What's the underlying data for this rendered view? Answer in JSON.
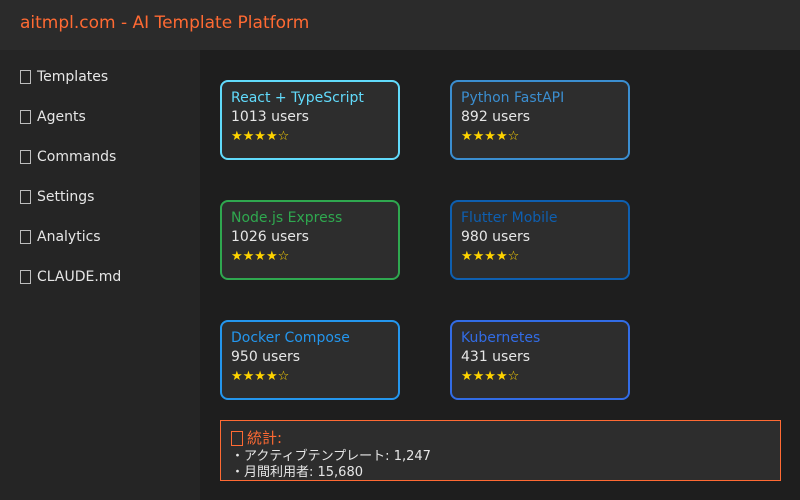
{
  "header": {
    "title": "aitmpl.com - AI Template Platform"
  },
  "sidebar": {
    "items": [
      {
        "label": "Templates"
      },
      {
        "label": "Agents"
      },
      {
        "label": "Commands"
      },
      {
        "label": "Settings"
      },
      {
        "label": "Analytics"
      },
      {
        "label": "CLAUDE.md"
      }
    ]
  },
  "templates": [
    {
      "name": "React + TypeScript",
      "users": "1013 users",
      "stars": "★★★★☆",
      "color": "#61dafb"
    },
    {
      "name": "Python FastAPI",
      "users": "892 users",
      "stars": "★★★★☆",
      "color": "#3b8ed0"
    },
    {
      "name": "Node.js Express",
      "users": "1026 users",
      "stars": "★★★★☆",
      "color": "#2fa84f"
    },
    {
      "name": "Flutter Mobile",
      "users": "980 users",
      "stars": "★★★★☆",
      "color": "#0e5fb0"
    },
    {
      "name": "Docker Compose",
      "users": "950 users",
      "stars": "★★★★☆",
      "color": "#2496ed"
    },
    {
      "name": "Kubernetes",
      "users": "431 users",
      "stars": "★★★★☆",
      "color": "#326ce5"
    }
  ],
  "stats": {
    "title": "統計:",
    "lines": [
      "・アクティブテンプレート: 1,247",
      "・月間利用者: 15,680"
    ]
  },
  "colors": {
    "accent": "#ff6a33",
    "star": "#ffd400"
  }
}
